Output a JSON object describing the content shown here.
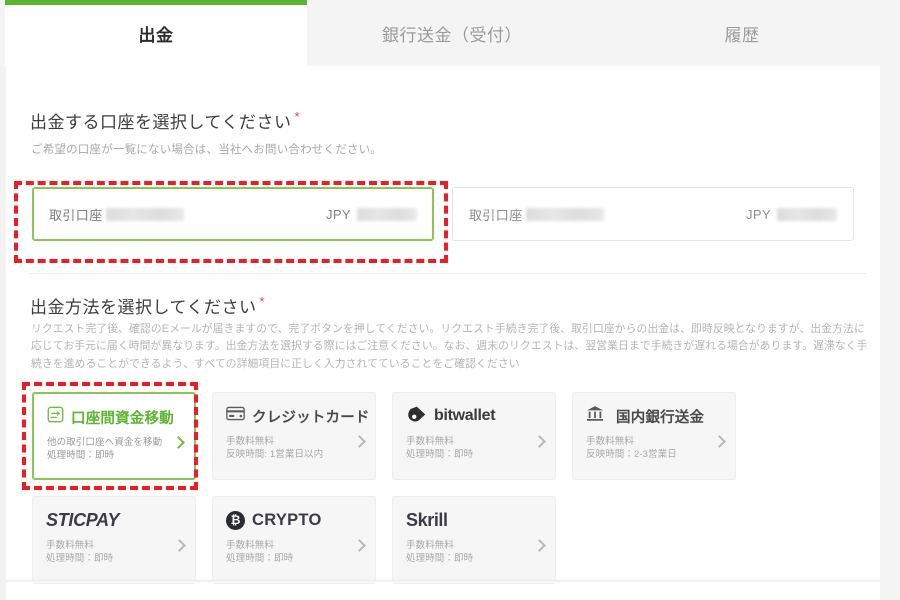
{
  "tabs": [
    {
      "label": "出金",
      "active": true
    },
    {
      "label": "銀行送金（受付）",
      "active": false
    },
    {
      "label": "履歴",
      "active": false
    }
  ],
  "account_section": {
    "title": "出金する口座を選択してください",
    "required_mark": "*",
    "subtitle": "ご希望の口座が一覧にない場合は、当社へお問い合わせください。",
    "cards": [
      {
        "label": "取引口座",
        "account_number": "",
        "currency": "JPY",
        "balance": "",
        "selected": true
      },
      {
        "label": "取引口座",
        "account_number": "",
        "currency": "JPY",
        "balance": "",
        "selected": false
      }
    ]
  },
  "method_section": {
    "title": "出金方法を選択してください",
    "required_mark": "*",
    "description": "リクエスト完了後、確認のEメールが届きますので、完了ボタンを押してください。リクエスト手続き完了後、取引口座からの出金は、即時反映となりますが、出金方法に応じてお手元に届く時間が異なります。出金方法を選択する際にはご注意ください。なお、週末のリクエストは、翌営業日まで手続きが遅れる場合があります。遅滞なく手続きを進めることができるよう、すべての詳細項目に正しく入力されてていることをご確認ください",
    "cards": [
      {
        "title": "口座間資金移動",
        "icon": "transfer-icon",
        "sub": "他の取引口座へ資金を移動\n処理時間：即時",
        "selected": true
      },
      {
        "title": "クレジットカード",
        "icon": "credit-card-icon",
        "sub": "手数料無料\n反映時間: 1営業日以内",
        "selected": false
      },
      {
        "title": "bitwallet",
        "icon": "bitwallet-logo",
        "sub": "手数料無料\n処理時間：即時",
        "selected": false
      },
      {
        "title": "国内銀行送金",
        "icon": "bank-icon",
        "sub": "手数料無料\n反映時間：2-3営業日",
        "selected": false
      },
      {
        "title": "STICPAY",
        "icon": "sticpay-logo",
        "sub": "手数料無料\n処理時間：即時",
        "selected": false
      },
      {
        "title": "CRYPTO",
        "icon": "bitcoin-icon",
        "sub": "手数料無料\n処理時間：即時",
        "selected": false
      },
      {
        "title": "Skrill",
        "icon": "skrill-logo",
        "sub": "手数料無料\n処理時間：即時",
        "selected": false
      }
    ]
  },
  "colors": {
    "accent_green": "#5cb531",
    "border_green": "#8ac653",
    "annotation_red": "#ee1c24",
    "required_red": "#e8453c"
  }
}
